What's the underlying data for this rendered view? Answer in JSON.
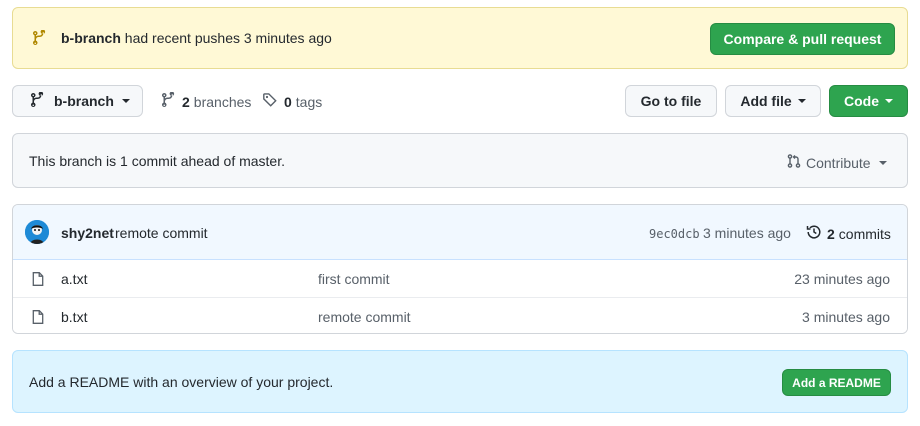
{
  "banner": {
    "branch": "b-branch",
    "message": "had recent pushes 3 minutes ago",
    "compare_button": "Compare & pull request"
  },
  "toolbar": {
    "branch_selector": "b-branch",
    "branches_count": "2",
    "branches_label": "branches",
    "tags_count": "0",
    "tags_label": "tags",
    "goto_file": "Go to file",
    "add_file": "Add file",
    "code": "Code"
  },
  "ahead": {
    "message": "This branch is 1 commit ahead of master.",
    "contribute": "Contribute"
  },
  "latest_commit": {
    "author": "shy2net",
    "message": "remote commit",
    "sha": "9ec0dcb",
    "time": "3 minutes ago",
    "commits_count": "2",
    "commits_label": "commits"
  },
  "files": [
    {
      "name": "a.txt",
      "message": "first commit",
      "time": "23 minutes ago"
    },
    {
      "name": "b.txt",
      "message": "remote commit",
      "time": "3 minutes ago"
    }
  ],
  "readme": {
    "message": "Add a README with an overview of your project.",
    "button": "Add a README"
  },
  "colors": {
    "green": "#2ea44f",
    "banner_bg": "#fff9d6",
    "info_bg": "#ddf4ff"
  },
  "icons": [
    "git-branch-icon",
    "tag-icon",
    "history-icon",
    "file-icon",
    "git-pull-request-icon"
  ]
}
